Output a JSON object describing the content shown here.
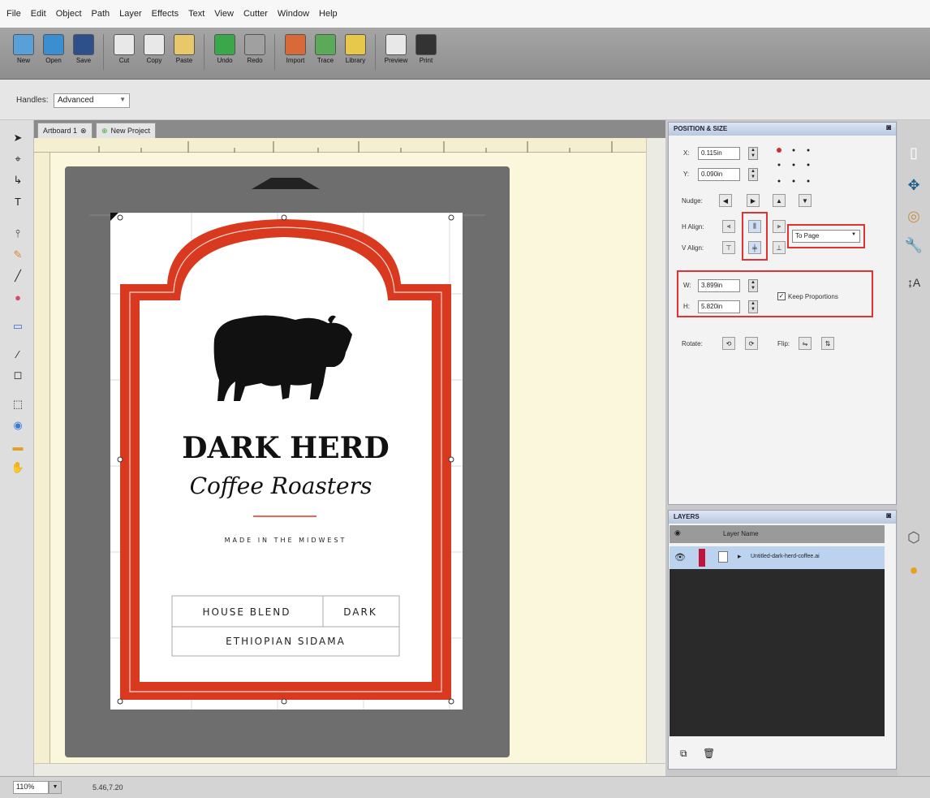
{
  "menu": [
    "File",
    "Edit",
    "Object",
    "Path",
    "Layer",
    "Effects",
    "Text",
    "View",
    "Cutter",
    "Window",
    "Help"
  ],
  "toolbar": {
    "buttons": [
      {
        "label": "New",
        "icon": "new-document-icon",
        "color": "#5aa0d8"
      },
      {
        "label": "Open",
        "icon": "open-globe-icon",
        "color": "#3b8fd0"
      },
      {
        "label": "Save",
        "icon": "save-disk-icon",
        "color": "#2d4f8a"
      },
      {
        "label": "Cut",
        "icon": "cut-icon",
        "color": "#e8e8e8"
      },
      {
        "label": "Copy",
        "icon": "copy-icon",
        "color": "#e8e8e8"
      },
      {
        "label": "Paste",
        "icon": "paste-icon",
        "color": "#e8c86a"
      },
      {
        "label": "Undo",
        "icon": "undo-arrow-icon",
        "color": "#3aa84a"
      },
      {
        "label": "Redo",
        "icon": "redo-arrow-icon",
        "color": "#a0a0a0"
      },
      {
        "label": "Import",
        "icon": "import-icon",
        "color": "#d86a3a"
      },
      {
        "label": "Trace",
        "icon": "trace-landscape-icon",
        "color": "#5aaa5a"
      },
      {
        "label": "Library",
        "icon": "library-icon",
        "color": "#e8c84a"
      },
      {
        "label": "Preview",
        "icon": "preview-icon",
        "color": "#e8e8e8"
      },
      {
        "label": "Print",
        "icon": "print-pen-icon",
        "color": "#333333"
      }
    ]
  },
  "optbar": {
    "label": "Handles:",
    "value": "Advanced"
  },
  "tabs": [
    {
      "label": "Artboard 1"
    },
    {
      "label": "New Project"
    }
  ],
  "label_design": {
    "brand": "DARK HERD",
    "script": "Coffee Roasters",
    "tagline": "MADE IN THE MIDWEST",
    "table": [
      [
        "HOUSE BLEND",
        "DARK"
      ],
      [
        "ETHIOPIAN SIDAMA"
      ]
    ],
    "colors": {
      "border": "#d9391f",
      "ink": "#111111",
      "rule": "#d9391f"
    }
  },
  "position_panel": {
    "title": "POSITION & SIZE",
    "x_label": "X:",
    "x_value": "0.115in",
    "y_label": "Y:",
    "y_value": "0.090in",
    "nudge_label": "Nudge:",
    "h_align_label": "H Align:",
    "v_align_label": "V Align:",
    "align_to": "To Page",
    "w_label": "W:",
    "w_value": "3.899in",
    "h_label": "H:",
    "h_value": "5.820in",
    "keep_proportions": "Keep Proportions",
    "rotate_label": "Rotate:",
    "flip_label": "Flip:"
  },
  "layers_panel": {
    "title": "LAYERS",
    "column": "Layer Name",
    "layer_name": "Untitled-dark-herd-coffee.ai",
    "layer_color": "#c0143c"
  },
  "status": {
    "zoom": "110%",
    "coords": "5.46,7.20"
  }
}
